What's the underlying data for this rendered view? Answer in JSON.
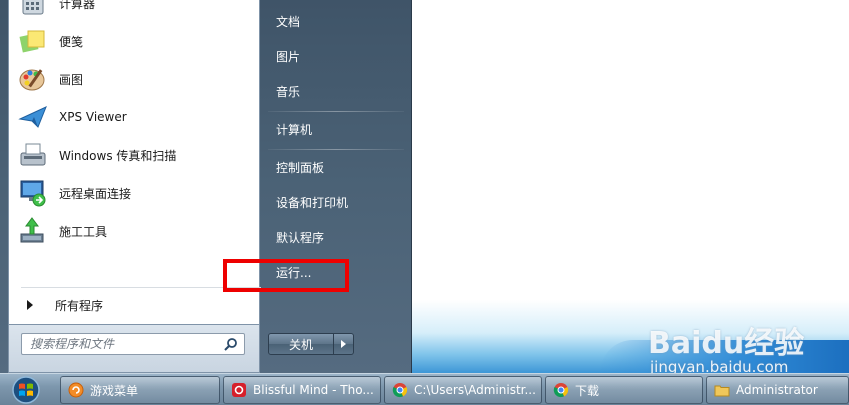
{
  "programs": [
    {
      "label": "计算器",
      "icon": "calculator-icon"
    },
    {
      "label": "便笺",
      "icon": "sticky-notes-icon"
    },
    {
      "label": "画图",
      "icon": "paint-icon"
    },
    {
      "label": "XPS Viewer",
      "icon": "xps-viewer-icon"
    },
    {
      "label": "Windows 传真和扫描",
      "icon": "fax-scan-icon"
    },
    {
      "label": "远程桌面连接",
      "icon": "remote-desktop-icon"
    },
    {
      "label": "施工工具",
      "icon": "construction-tool-icon"
    }
  ],
  "all_programs_label": "所有程序",
  "search": {
    "placeholder": "搜索程序和文件"
  },
  "right_items": [
    {
      "label": "文档"
    },
    {
      "label": "图片"
    },
    {
      "label": "音乐"
    },
    {
      "label": "计算机"
    },
    {
      "label": "控制面板"
    },
    {
      "label": "设备和打印机"
    },
    {
      "label": "默认程序"
    },
    {
      "label": "运行..."
    }
  ],
  "shutdown_label": "关机",
  "taskbar": {
    "buttons": [
      {
        "label": "游戏菜单",
        "icon": "game-menu-icon"
      },
      {
        "label": "Blissful Mind - Tho...",
        "icon": "netease-music-icon"
      },
      {
        "label": "C:\\Users\\Administr...",
        "icon": "chrome-icon"
      },
      {
        "label": "下载",
        "icon": "chrome-icon"
      },
      {
        "label": "Administrator",
        "icon": "folder-icon"
      }
    ]
  },
  "watermark": {
    "brand": "Baidu经验",
    "url": "jingyan.baidu.com"
  },
  "colors": {
    "highlight": "#ee0000",
    "menu_bg": "#4b6276"
  }
}
